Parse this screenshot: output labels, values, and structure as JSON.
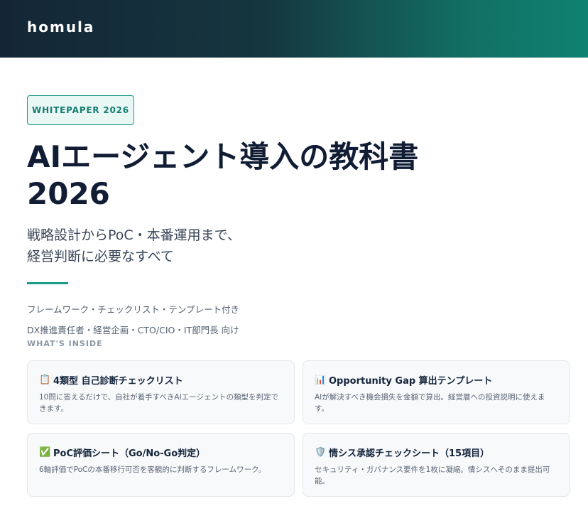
{
  "header": {
    "brand": "homula"
  },
  "badge": {
    "label": "WHITEPAPER 2026"
  },
  "title": {
    "line1": "AIエージェント導入の教科書",
    "line2": "2026"
  },
  "subtitle": {
    "line1": "戦略設計からPoC・本番運用まで、",
    "line2": "経営判断に必要なすべて"
  },
  "meta": {
    "features": "フレームワーク・チェックリスト・テンプレート付き",
    "audience": "DX推進責任者・経営企画・CTO/CIO・IT部門長 向け"
  },
  "section": {
    "label": "WHAT'S INSIDE"
  },
  "cards": [
    {
      "icon": "clipboard-icon",
      "glyph": "📋",
      "title": "4類型 自己診断チェックリスト",
      "desc": "10問に答えるだけで、自社が着手すべきAIエージェントの類型を判定できます。"
    },
    {
      "icon": "bar-chart-icon",
      "glyph": "📊",
      "title": "Opportunity Gap 算出テンプレート",
      "desc": "AIが解決すべき機会損失を金額で算出。経営層への投資説明に使えます。"
    },
    {
      "icon": "check-mark-icon",
      "glyph": "✅",
      "title": "PoC評価シート（Go/No-Go判定）",
      "desc": "6軸評価でPoCの本番移行可否を客観的に判断するフレームワーク。"
    },
    {
      "icon": "shield-icon",
      "glyph": "🛡️",
      "title": "情シス承認チェックシート（15項目）",
      "desc": "セキュリティ・ガバナンス要件を1枚に凝縮。情シスへそのまま提出可能。"
    }
  ],
  "colors": {
    "accent": "#1a9a8a",
    "header_dark": "#142636",
    "header_teal": "#0f8272",
    "title": "#111d35"
  }
}
